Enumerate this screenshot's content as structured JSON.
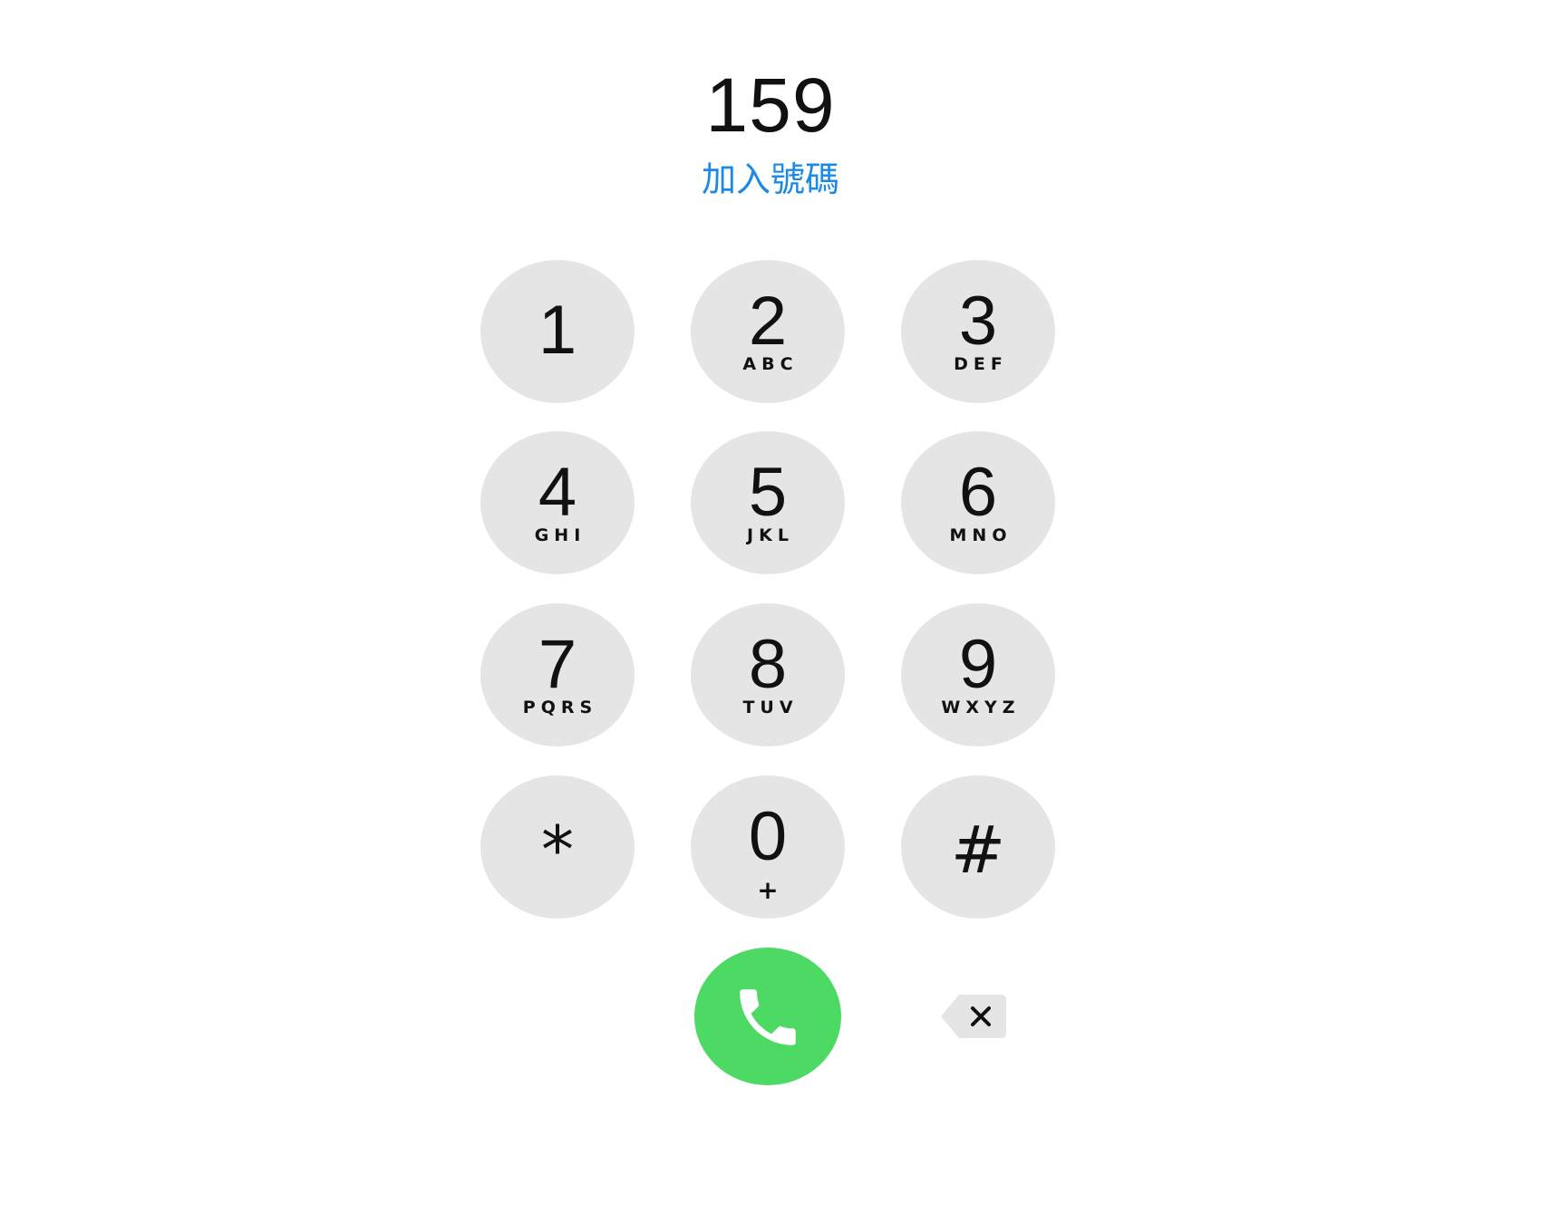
{
  "display": {
    "number": "159",
    "add_number_label": "加入號碼"
  },
  "keypad": {
    "keys": [
      {
        "digit": "1",
        "letters": ""
      },
      {
        "digit": "2",
        "letters": "ABC"
      },
      {
        "digit": "3",
        "letters": "DEF"
      },
      {
        "digit": "4",
        "letters": "GHI"
      },
      {
        "digit": "5",
        "letters": "JKL"
      },
      {
        "digit": "6",
        "letters": "MNO"
      },
      {
        "digit": "7",
        "letters": "PQRS"
      },
      {
        "digit": "8",
        "letters": "TUV"
      },
      {
        "digit": "9",
        "letters": "WXYZ"
      },
      {
        "digit": "*",
        "letters": ""
      },
      {
        "digit": "0",
        "letters": "+"
      },
      {
        "digit": "#",
        "letters": ""
      }
    ]
  },
  "actions": {
    "call_icon": "phone-icon",
    "delete_icon": "backspace-icon"
  },
  "colors": {
    "key_background": "#e5e5e5",
    "call_green": "#4cd964",
    "link_blue": "#1a8ae6"
  }
}
